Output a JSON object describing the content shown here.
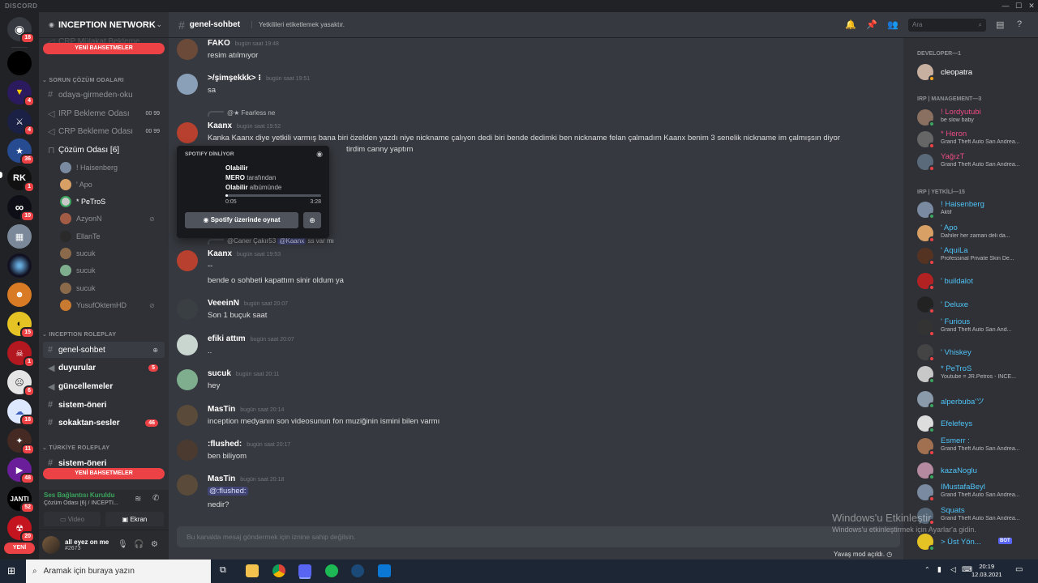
{
  "window": {
    "title": "DISCORD"
  },
  "server": {
    "name": "INCEPTION NETWORK",
    "categories": {
      "sorun": "SORUN ÇÖZÜM ODALARI",
      "roleplay": "INCEPTION ROLEPLAY",
      "turkiye": "TÜRKİYE ROLEPLAY"
    },
    "top_overlap": "CRP Mülakat Bekleme",
    "channels_voice": [
      {
        "label": "odaya-girmeden-oku"
      },
      {
        "label": "IRP Bekleme Odası",
        "limit": "00 99"
      },
      {
        "label": "CRP Bekleme Odası",
        "limit": "00 99"
      },
      {
        "label": "Çözüm Odası [6]"
      }
    ],
    "voice_users": [
      "! Haisenberg",
      "' Apo",
      "* PeTroS",
      "AzyonN",
      "EllanTe",
      "sucuk",
      "sucuk",
      "sucuk",
      "YusufOktemHD"
    ],
    "channels_rp": [
      {
        "label": "genel-sohbet"
      },
      {
        "label": "duyurular",
        "count": "5"
      },
      {
        "label": "güncellemeler"
      },
      {
        "label": "sistem-öneri"
      },
      {
        "label": "sokaktan-sesler",
        "count": "46"
      }
    ],
    "channel_tr": "sistem-öneri",
    "new_mentions": "YENİ BAHSETMELER"
  },
  "guild_badges": [
    "18",
    "4",
    "4",
    "36",
    "1",
    "10",
    "15",
    "1",
    "6",
    "18",
    "11",
    "48",
    "52",
    "20"
  ],
  "guild_labels": [
    "RK",
    "JANTI"
  ],
  "guild_new": "YENİ",
  "voice": {
    "status": "Ses Bağlantısı Kuruldu",
    "sub": "Çözüm Odası [6] / INCEPTI...",
    "video": "Video",
    "screen": "Ekran"
  },
  "user": {
    "name": "all eyez on me",
    "tag": "#2673"
  },
  "chat": {
    "channel": "genel-sohbet",
    "topic": "Yetkilileri etiketlemek yasaktır.",
    "search_placeholder": "Ara",
    "input_placeholder": "Bu kanalda mesaj göndermek için iznine sahip değilsin.",
    "slowmode": "Yavaş mod açıldı."
  },
  "messages": [
    {
      "author": "FAKO",
      "time": "bugün saat 19:48",
      "text": "resim atılmıyor",
      "color": "#6b4a3a"
    },
    {
      "author": ">/şimşekkk> ⁝",
      "time": "bugün saat 19:51",
      "text": "sa",
      "color": "#8aa0b8"
    },
    {
      "author": "Kaanx",
      "time": "bugün saat 19:52",
      "reply": "@★ Fearless ne",
      "text": "Kanka Kaanx diye yetkili varmış bana biri özelden yazdı niye nickname çalıyon dedi biri bende dedimki ben nickname felan çalmadım Kaanx benim 3 senelik nickname im çalmışsın diyor",
      "text2": "tirdim canny yaptım",
      "color": "#b8402e"
    },
    {
      "author": "Kaanx",
      "time": "bugün saat 19:53",
      "reply_user": "@Caner Çakır53",
      "reply_mention": "@Kaanx",
      "reply_tail": "ss var mı",
      "text": "--",
      "text2": "bende o sohbeti kapattım sinir oldum ya",
      "color": "#b8402e"
    },
    {
      "author": "VeeeinN",
      "time": "bugün saat 20:07",
      "text": "Son 1 buçuk saat",
      "color": "#3a3f44"
    },
    {
      "author": "efiki attım",
      "time": "bugün saat 20:07",
      "text": "..",
      "color": "#c9d6d0"
    },
    {
      "author": "sucuk",
      "time": "bugün saat 20:11",
      "text": "hey",
      "color": "#7fae8e"
    },
    {
      "author": "MasTin",
      "time": "bugün saat 20:14",
      "text": "inception medyanın son videosunun fon muziğinin ismini bilen varmı",
      "color": "#5a4a3a"
    },
    {
      "author": ":flushed:",
      "time": "bugün saat 20:17",
      "text": "ben biliyom",
      "color": "#4a3a30"
    },
    {
      "author": "MasTin",
      "time": "bugün saat 20:18",
      "mention": "@:flushed:",
      "text2": "nedir?",
      "color": "#5a4a3a"
    }
  ],
  "spotify": {
    "header": "SPOTIFY DİNLİYOR",
    "title": "Olabilir",
    "artist": "MERO",
    "artist_suffix": "tarafından",
    "album": "Olabilir",
    "album_suffix": "albümünde",
    "elapsed": "0:05",
    "total": "3:28",
    "progress": 0.024,
    "play_button": "Spotify üzerinde oynat"
  },
  "members": {
    "categories": [
      "DEVELOPER—1",
      "IRP | MANAGEMENT—3",
      "IRP | YETKİLİ—15"
    ],
    "list": [
      {
        "name": "cleopatra",
        "color": "#fff",
        "status": "#faa61a"
      },
      {
        "name": "! Lordyutubi",
        "activity": "be slow baby",
        "color": "#ed4b82",
        "status": "#3ba55d"
      },
      {
        "name": "* Heron",
        "activity": "Grand Theft Auto San Andrea...",
        "color": "#ed4b82",
        "status": "#ed4245"
      },
      {
        "name": "YağızT",
        "activity": "Grand Theft Auto San Andrea...",
        "color": "#ed4b82",
        "status": "#ed4245"
      },
      {
        "name": "! Haisenberg",
        "activity": "Aktif",
        "color": "#4fc3f7",
        "status": "#3ba55d"
      },
      {
        "name": "' Apo",
        "activity": "Dahiler her zaman deli da...",
        "color": "#4fc3f7",
        "status": "#ed4245"
      },
      {
        "name": "' AquiLa",
        "activity": "Professinal Private Skin De...",
        "color": "#4fc3f7",
        "status": "#ed4245"
      },
      {
        "name": "' buildalot",
        "color": "#4fc3f7",
        "status": "#ed4245"
      },
      {
        "name": "' Deluxe",
        "color": "#4fc3f7",
        "status": "#ed4245"
      },
      {
        "name": "' Furious",
        "activity": "Grand Theft Auto San And...",
        "color": "#4fc3f7",
        "status": "#ed4245"
      },
      {
        "name": "' Vhiskey",
        "color": "#4fc3f7",
        "status": "#ed4245"
      },
      {
        "name": "* PeTroS",
        "activity": "Youtube = JR.Petros - İNCE...",
        "color": "#4fc3f7",
        "status": "#3ba55d"
      },
      {
        "name": "alperbuba'ツ",
        "color": "#4fc3f7",
        "status": "#3ba55d"
      },
      {
        "name": "Efelefeys",
        "color": "#4fc3f7",
        "status": "#3ba55d"
      },
      {
        "name": "Esmerr :",
        "activity": "Grand Theft Auto San Andrea...",
        "color": "#4fc3f7",
        "status": "#ed4245"
      },
      {
        "name": "kazaNoglu",
        "color": "#4fc3f7",
        "status": "#3ba55d"
      },
      {
        "name": "IMustafaBeyl",
        "activity": "Grand Theft Auto San Andrea...",
        "color": "#4fc3f7",
        "status": "#ed4245"
      },
      {
        "name": "Squats",
        "activity": "Grand Theft Auto San Andrea...",
        "color": "#4fc3f7",
        "status": "#ed4245"
      },
      {
        "name": "> Üst Yön...",
        "badge": "BOT",
        "color": "#4fc3f7",
        "status": "#3ba55d"
      }
    ]
  },
  "watermark": {
    "line1": "Windows'u Etkinleştir",
    "line2": "Windows'u etkinleştirmek için Ayarlar'a gidin."
  },
  "taskbar": {
    "search": "Aramak için buraya yazın",
    "time": "20:19",
    "date": "12.03.2021"
  },
  "colors": {
    "discord_red": "#ed4245",
    "online": "#3ba55d",
    "blurple": "#5865f2"
  }
}
